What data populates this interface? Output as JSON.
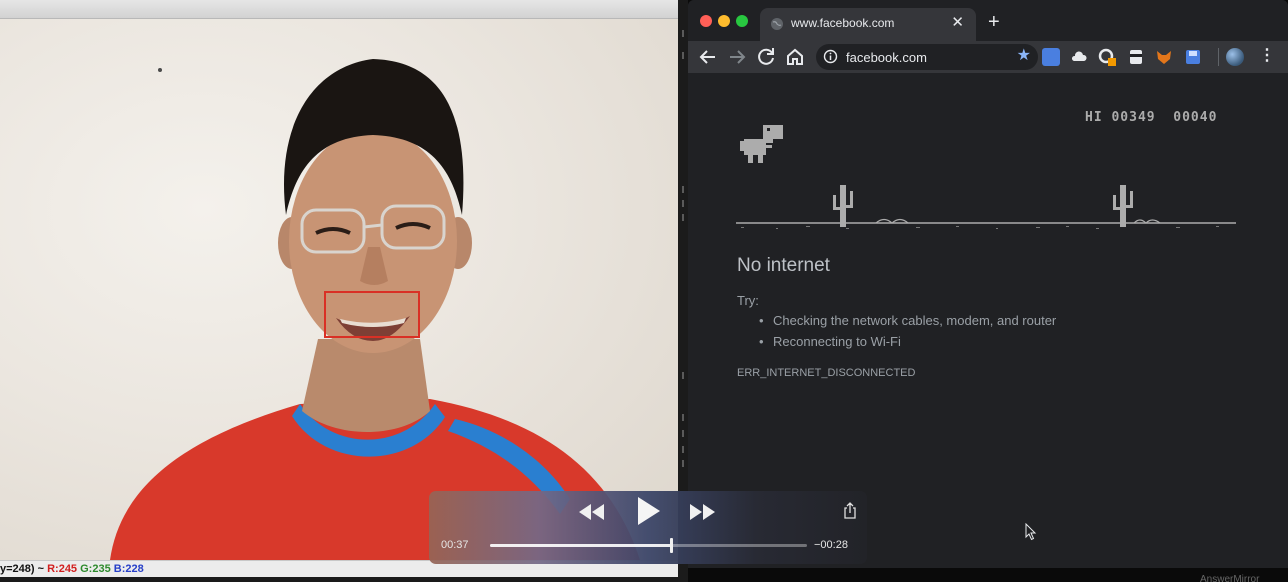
{
  "camera": {
    "status_prefix": "y=248) ~ ",
    "r_label": "R:245",
    "g_label": "G:235",
    "b_label": "B:228",
    "detection_box_color": "#d93025"
  },
  "browser": {
    "tab_title": "www.facebook.com",
    "tab_close": "✕",
    "new_tab": "+",
    "url": "facebook.com",
    "star": "★",
    "menu": "⋮",
    "dino_score": "HI 00349  00040",
    "error_title": "No internet",
    "try_label": "Try:",
    "suggestions": [
      "Checking the network cables, modem, and router",
      "Reconnecting to Wi-Fi"
    ],
    "error_code": "ERR_INTERNET_DISCONNECTED",
    "accent_star": "#8ab4f8"
  },
  "player": {
    "elapsed": "00:37",
    "remaining": "−00:28",
    "progress": 0.57
  },
  "watermark": "AnswerMirror"
}
